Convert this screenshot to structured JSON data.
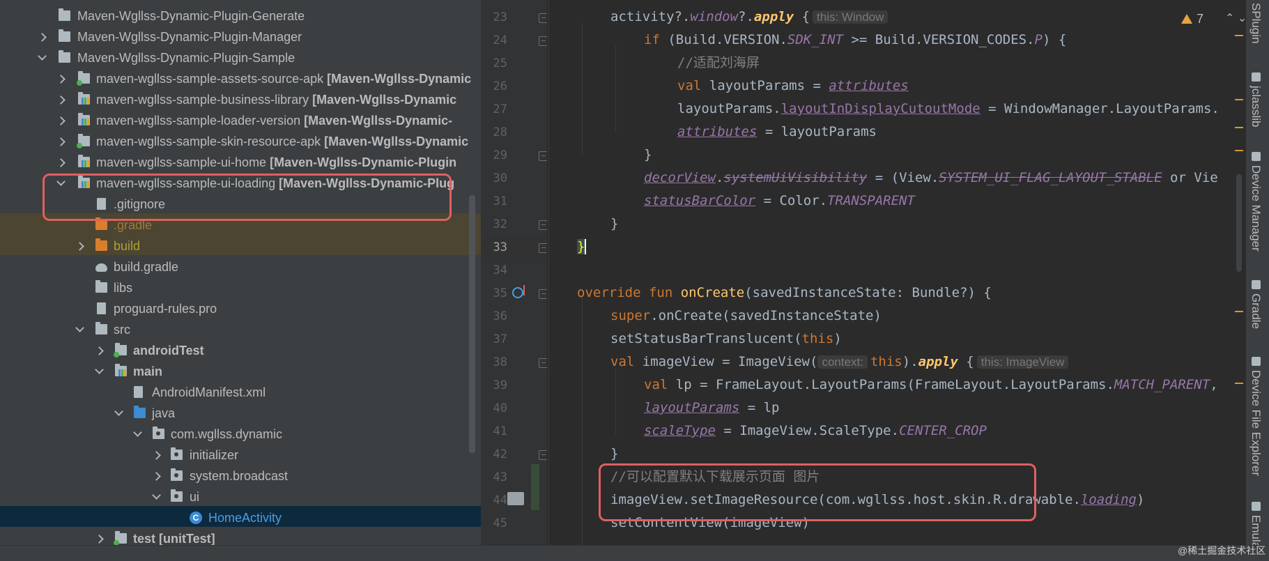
{
  "tree": {
    "items": [
      {
        "label": "Maven-Wgllss-Dynamic-Plugin-Generate",
        "module": "",
        "icon": "folder-icon"
      },
      {
        "label": "Maven-Wgllss-Dynamic-Plugin-Manager",
        "module": "",
        "icon": "folder-icon"
      },
      {
        "label": "Maven-Wgllss-Dynamic-Plugin-Sample",
        "module": "",
        "icon": "folder-icon"
      },
      {
        "label": "maven-wgllss-sample-assets-source-apk ",
        "module": "[Maven-Wgllss-Dynamic",
        "icon": "android-module-icon"
      },
      {
        "label": "maven-wgllss-sample-business-library ",
        "module": "[Maven-Wgllss-Dynamic",
        "icon": "library-module-icon"
      },
      {
        "label": "maven-wgllss-sample-loader-version ",
        "module": "[Maven-Wgllss-Dynamic-",
        "icon": "library-module-icon"
      },
      {
        "label": "maven-wgllss-sample-skin-resource-apk ",
        "module": "[Maven-Wgllss-Dynamic",
        "icon": "android-module-icon"
      },
      {
        "label": "maven-wgllss-sample-ui-home ",
        "module": "[Maven-Wgllss-Dynamic-Plugin",
        "icon": "library-module-icon"
      },
      {
        "label": "maven-wgllss-sample-ui-loading ",
        "module": "[Maven-Wgllss-Dynamic-Plug",
        "icon": "library-module-icon"
      },
      {
        "label": ".gitignore",
        "module": "",
        "icon": "gitignore-file-icon"
      },
      {
        "label": ".gradle",
        "module": "",
        "icon": "folder-icon"
      },
      {
        "label": "build",
        "module": "",
        "icon": "folder-icon"
      },
      {
        "label": "build.gradle",
        "module": "",
        "icon": "gradle-file-icon"
      },
      {
        "label": "libs",
        "module": "",
        "icon": "folder-icon"
      },
      {
        "label": "proguard-rules.pro",
        "module": "",
        "icon": "file-icon"
      },
      {
        "label": "src",
        "module": "",
        "icon": "folder-icon"
      },
      {
        "label": "androidTest",
        "module": "",
        "icon": "test-folder-icon"
      },
      {
        "label": "main",
        "module": "",
        "icon": "source-folder-icon"
      },
      {
        "label": "AndroidManifest.xml",
        "module": "",
        "icon": "manifest-file-icon"
      },
      {
        "label": "java",
        "module": "",
        "icon": "folder-icon"
      },
      {
        "label": "com.wgllss.dynamic",
        "module": "",
        "icon": "package-icon"
      },
      {
        "label": "initializer",
        "module": "",
        "icon": "package-icon"
      },
      {
        "label": "system.broadcast",
        "module": "",
        "icon": "package-icon"
      },
      {
        "label": "ui",
        "module": "",
        "icon": "package-icon"
      },
      {
        "label": "HomeActivity",
        "module": "",
        "icon": "kotlin-class-icon"
      },
      {
        "label": "test ",
        "module": "[unitTest]",
        "icon": "test-folder-icon"
      }
    ]
  },
  "editor": {
    "line_numbers": [
      "23",
      "24",
      "25",
      "26",
      "27",
      "28",
      "29",
      "30",
      "31",
      "32",
      "33",
      "34",
      "35",
      "36",
      "37",
      "38",
      "39",
      "40",
      "41",
      "42",
      "43",
      "44",
      "45"
    ],
    "hints": {
      "window": "this: Window",
      "context": "context:",
      "imageview": "this: ImageView"
    },
    "warnings_count": "7",
    "lines": {
      "l23": [
        "activity",
        "?.",
        "window",
        "?.",
        "apply",
        " {"
      ],
      "l24": [
        "if",
        " (Build.VERSION.",
        "SDK_INT",
        " >= Build.VERSION_CODES.",
        "P",
        ") {"
      ],
      "l25": [
        "//适配刘海屏"
      ],
      "l26": [
        "val",
        " layoutParams = ",
        "attributes"
      ],
      "l27": [
        "layoutParams.",
        "layoutInDisplayCutoutMode",
        " = WindowManager.LayoutParams."
      ],
      "l28": [
        "attributes",
        " = layoutParams"
      ],
      "l29": [
        "}"
      ],
      "l30": [
        "decorView",
        ".",
        "systemUiVisibility",
        " = (View.",
        "SYSTEM_UI_FLAG_LAYOUT_STABLE",
        " or Vie"
      ],
      "l31": [
        "statusBarColor",
        " = Color.",
        "TRANSPARENT"
      ],
      "l32": [
        "}"
      ],
      "l33": [
        "}"
      ],
      "l35": [
        "override fun ",
        "onCreate",
        "(savedInstanceState: Bundle?) {"
      ],
      "l36": [
        "super",
        ".onCreate(savedInstanceState)"
      ],
      "l37": [
        "setStatusBarTranslucent(",
        "this",
        ")"
      ],
      "l38": [
        "val",
        " imageView = ImageView(",
        "this",
        ").",
        "apply",
        " {"
      ],
      "l39": [
        "val",
        " lp = FrameLayout.LayoutParams(FrameLayout.LayoutParams.",
        "MATCH_PARENT",
        ","
      ],
      "l40": [
        "layoutParams",
        " = lp"
      ],
      "l41": [
        "scaleType",
        " = ImageView.ScaleType.",
        "CENTER_CROP"
      ],
      "l42": [
        "}"
      ],
      "l43": [
        "//可以配置默认下载展示页面 图片"
      ],
      "l44": [
        "imageView.setImageResource(com.wgllss.host.skin.R.drawable.",
        "loading",
        ")"
      ],
      "l45": [
        "setContentView(imageView)"
      ]
    }
  },
  "toolstrip": {
    "tabs": [
      "SPlugin",
      "jclasslib",
      "Device Manager",
      "Gradle",
      "Device File Explorer",
      "Emula"
    ]
  },
  "watermark": "@稀土掘金技术社区"
}
